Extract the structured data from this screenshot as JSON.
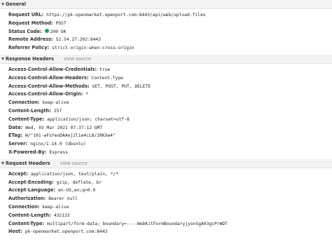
{
  "general": {
    "title": "General",
    "rows": [
      {
        "key": "Request URL:",
        "value": "https://pk-openmarket.openport.com:8443/api/web/upload-files"
      },
      {
        "key": "Request Method:",
        "value": "POST"
      },
      {
        "key": "Status Code:",
        "value": "200 OK",
        "status_color": "#1aa260"
      },
      {
        "key": "Remote Address:",
        "value": "52.54.27.202:8443"
      },
      {
        "key": "Referrer Policy:",
        "value": "strict-origin-when-cross-origin"
      }
    ]
  },
  "response_headers": {
    "title": "Response Headers",
    "view_source": "view source",
    "rows": [
      {
        "key": "Access-Control-Allow-Credentials:",
        "value": "true"
      },
      {
        "key": "Access-Control-Allow-Headers:",
        "value": "Content-Type"
      },
      {
        "key": "Access-Control-Allow-Methods:",
        "value": "GET, POST, PUT, DELETE"
      },
      {
        "key": "Access-Control-Allow-Origin:",
        "value": "*"
      },
      {
        "key": "Connection:",
        "value": "keep-alive"
      },
      {
        "key": "Content-Length:",
        "value": "257"
      },
      {
        "key": "Content-Type:",
        "value": "application/json; charset=utf-8"
      },
      {
        "key": "Date:",
        "value": "Wed, 03 Mar 2021 07:37:12 GMT"
      },
      {
        "key": "ETag:",
        "value": "W/\"101-wFsYeoDAAej2l1e4cL8/1RKXw4\""
      },
      {
        "key": "Server:",
        "value": "nginx/1.14.0 (Ubuntu)"
      },
      {
        "key": "X-Powered-By:",
        "value": "Express"
      }
    ]
  },
  "request_headers": {
    "title": "Request Headers",
    "view_source": "view source",
    "rows": [
      {
        "key": "Accept:",
        "value": "application/json, text/plain, */*"
      },
      {
        "key": "Accept-Encoding:",
        "value": "gzip, deflate, br"
      },
      {
        "key": "Accept-Language:",
        "value": "en-US,en;q=0.9"
      },
      {
        "key": "Authorization:",
        "value": "Bearer null"
      },
      {
        "key": "Connection:",
        "value": "keep-alive"
      },
      {
        "key": "Content-Length:",
        "value": "432133"
      },
      {
        "key": "Content-Type:",
        "value": "multipart/form-data; boundary=----WebKitFormBoundaryjyonSgA03gcPrWDT"
      },
      {
        "key": "Host:",
        "value": "pk-openmarket.openport.com:8443"
      }
    ]
  }
}
